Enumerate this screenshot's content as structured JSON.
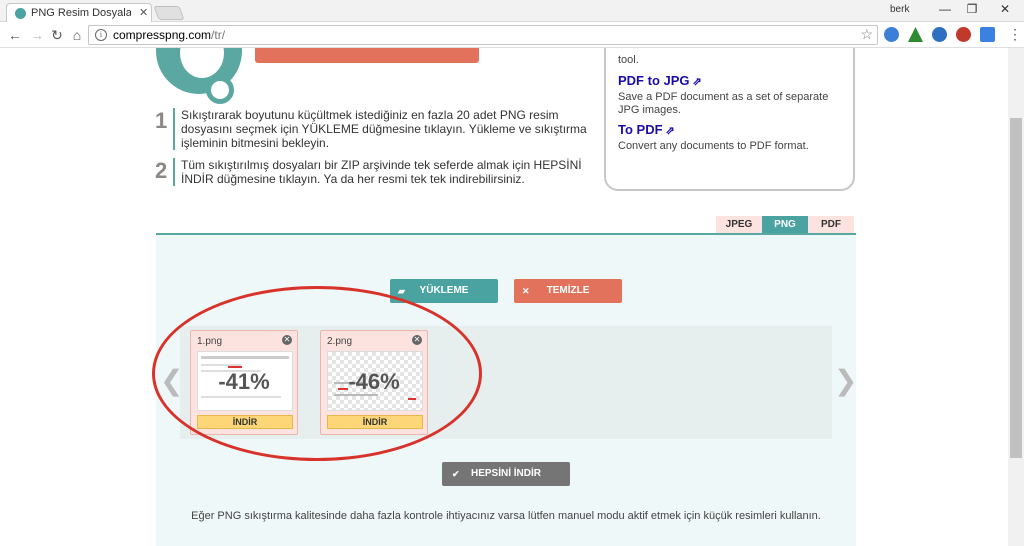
{
  "browser": {
    "tab_title": "PNG Resim Dosyalarını Ç",
    "tab_close": "✕",
    "profile_name": "berk",
    "url_host": "compresspng.com",
    "url_path": "/tr/",
    "window_min": "—",
    "window_restore": "❐",
    "window_close": "✕"
  },
  "steps": [
    {
      "num": "1",
      "text": "Sıkıştırarak boyutunu küçültmek istediğiniz en fazla 20 adet PNG resim dosyasını seçmek için YÜKLEME düğmesine tıklayın. Yükleme ve sıkıştırma işleminin bitmesini bekleyin."
    },
    {
      "num": "2",
      "text": "Tüm sıkıştırılmış dosyaları bir ZIP arşivinde tek seferde almak için HEPSİNİ İNDİR düğmesine tıklayın. Ya da her resmi tek tek indirebilirsiniz."
    }
  ],
  "side_card": {
    "top_text": "tool.",
    "pdf_to_jpg_title": "PDF to JPG",
    "pdf_to_jpg_desc": "Save a PDF document as a set of separate JPG images.",
    "to_pdf_title": "To PDF",
    "to_pdf_desc": "Convert any documents to PDF format.",
    "arrow": "⇗"
  },
  "format_tabs": [
    {
      "label": "JPEG",
      "active": false
    },
    {
      "label": "PNG",
      "active": true
    },
    {
      "label": "PDF",
      "active": false
    }
  ],
  "buttons": {
    "upload_label": "YÜKLEME",
    "clear_label": "TEMİZLE",
    "download_all_label": "HEPSİNİ İNDİR",
    "upload_icon": "▰",
    "clear_icon": "✕",
    "download_all_icon": "✔"
  },
  "files": [
    {
      "name": "1.png",
      "percent": "-41%",
      "download_label": "İNDİR",
      "close": "✕"
    },
    {
      "name": "2.png",
      "percent": "-46%",
      "download_label": "İNDİR",
      "close": "✕"
    }
  ],
  "carousel": {
    "prev": "❮",
    "next": "❯"
  },
  "hint": "Eğer PNG sıkıştırma kalitesinde daha fazla kontrole ihtiyacınız varsa lütfen manuel modu aktif etmek için küçük resimleri kullanın.",
  "colors": {
    "teal": "#4aa3a0",
    "coral": "#e2725b",
    "download_all_bg": "#757575",
    "annotation_red": "#d8332a"
  },
  "icons": [
    "back-arrow-icon",
    "forward-arrow-icon",
    "reload-icon",
    "home-icon",
    "info-icon",
    "star-icon",
    "menu-icon"
  ]
}
